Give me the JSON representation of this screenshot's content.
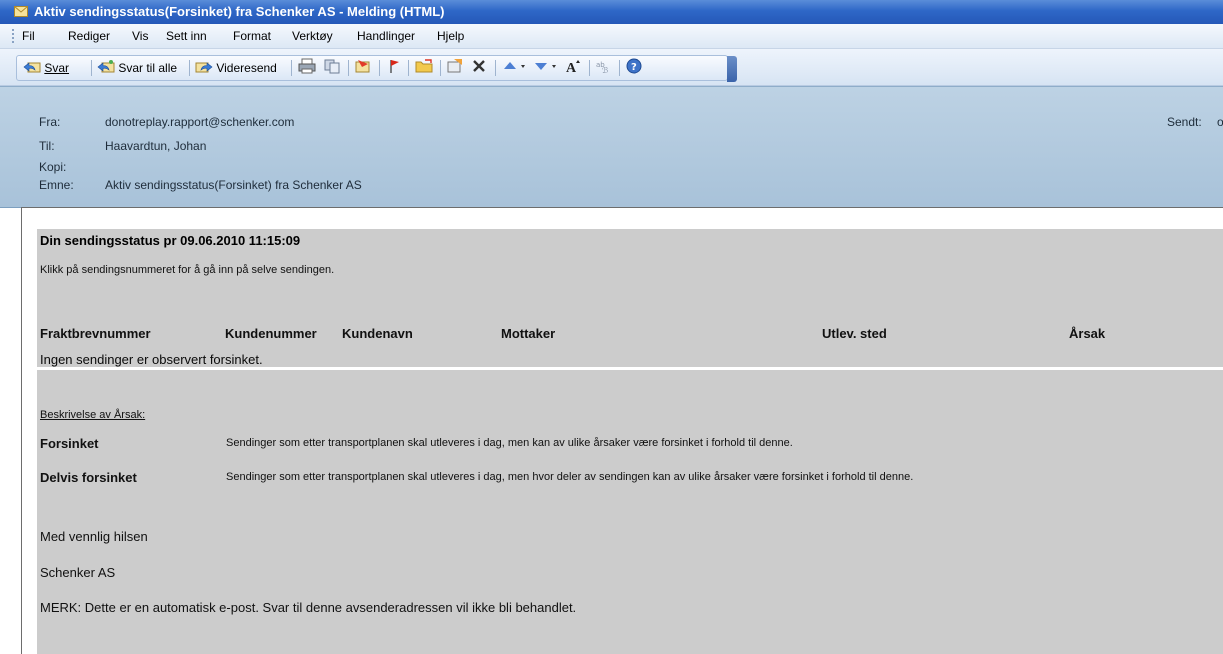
{
  "window": {
    "title": "Aktiv sendingsstatus(Forsinket) fra Schenker AS - Melding (HTML)"
  },
  "menu": [
    "Fil",
    "Rediger",
    "Vis",
    "Sett inn",
    "Format",
    "Verktøy",
    "Handlinger",
    "Hjelp"
  ],
  "toolbar": {
    "reply": "Svar",
    "reply_all": "Svar til alle",
    "forward": "Videresend"
  },
  "header": {
    "from_label": "Fra:",
    "from_value": "donotreplay.rapport@schenker.com",
    "to_label": "Til:",
    "to_value": "Haavardtun, Johan",
    "cc_label": "Kopi:",
    "subject_label": "Emne:",
    "subject_value": "Aktiv sendingsstatus(Forsinket) fra Schenker AS",
    "sent_label": "Sendt:",
    "sent_value": "o"
  },
  "body": {
    "title": "Din sendingsstatus pr 09.06.2010 11:15:09",
    "instruction": "Klikk på sendingsnummeret for å gå inn på selve sendingen.",
    "columns": [
      "Fraktbrevnummer",
      "Kundenummer",
      "Kundenavn",
      "Mottaker",
      "Utlev. sted",
      "Årsak"
    ],
    "no_shipments": "Ingen sendinger er observert forsinket.",
    "description_heading": "Beskrivelse av Årsak:",
    "reasons": [
      {
        "term": "Forsinket",
        "text": "Sendinger som etter transportplanen skal utleveres i dag, men kan av ulike årsaker være forsinket i forhold til denne."
      },
      {
        "term": "Delvis forsinket",
        "text": "Sendinger som etter transportplanen skal utleveres i dag, men hvor deler av sendingen kan av ulike årsaker være forsinket i forhold til denne."
      }
    ],
    "greeting": "Med vennlig hilsen",
    "company": "Schenker AS",
    "note": "MERK: Dette er en automatisk e-post. Svar til denne avsenderadressen vil ikke bli behandlet."
  }
}
